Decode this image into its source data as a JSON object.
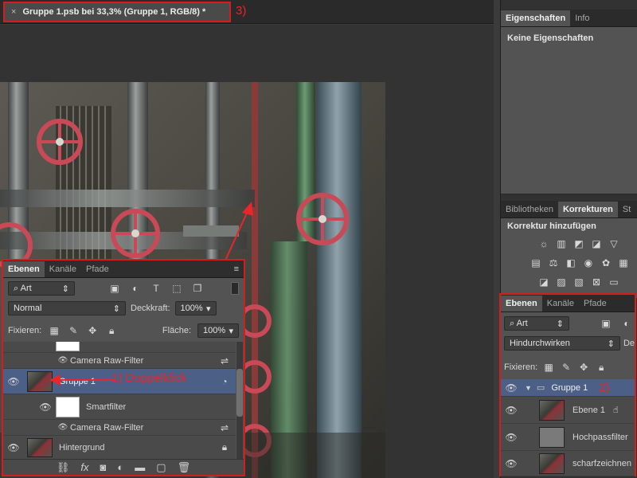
{
  "document_tab": {
    "title": "Gruppe 1.psb bei 33,3% (Gruppe 1, RGB/8) *",
    "close_glyph": "×",
    "annotation": "3)"
  },
  "properties_panel": {
    "tabs": [
      "Eigenschaften",
      "Info"
    ],
    "content": "Keine Eigenschaften"
  },
  "adjustments_panel": {
    "tabs": [
      "Bibliotheken",
      "Korrekturen",
      "St"
    ],
    "heading": "Korrektur hinzufügen",
    "row1_icons": [
      "brightness-icon",
      "levels-icon",
      "curves-icon",
      "exposure-icon",
      "vibrance-icon"
    ],
    "row2_icons": [
      "hue-saturation-icon",
      "color-balance-icon",
      "black-white-icon",
      "photo-filter-icon",
      "channel-mixer-icon",
      "color-lookup-icon"
    ],
    "row3_icons": [
      "invert-icon",
      "posterize-icon",
      "threshold-icon",
      "selective-color-icon",
      "gradient-map-icon"
    ]
  },
  "floating_layers": {
    "tabs": [
      "Ebenen",
      "Kanäle",
      "Pfade"
    ],
    "filter_kind": "Art",
    "blend_mode": "Normal",
    "opacity_label": "Deckkraft:",
    "opacity_value": "100%",
    "lock_label": "Fixieren:",
    "fill_label": "Fläche:",
    "fill_value": "100%",
    "layers": {
      "camera_raw_top": "Camera Raw-Filter",
      "gruppe": "Gruppe 1",
      "smartfilter": "Smartfilter",
      "camera_raw_bottom": "Camera Raw-Filter",
      "hintergrund": "Hintergrund"
    },
    "annotation": "1) Doppelklick"
  },
  "docked_layers": {
    "tabs": [
      "Ebenen",
      "Kanäle",
      "Pfade"
    ],
    "filter_kind": "Art",
    "blend_mode": "Hindurchwirken",
    "opacity_label_cut": "De",
    "lock_label": "Fixieren:",
    "layers": [
      "Gruppe 1",
      "Ebene 1",
      "Hochpassfilter",
      "scharfzeichnen"
    ],
    "annotation": "2)"
  },
  "colors": {
    "annotation_red": "#e8262b",
    "selected_layer": "#4c5f87"
  }
}
